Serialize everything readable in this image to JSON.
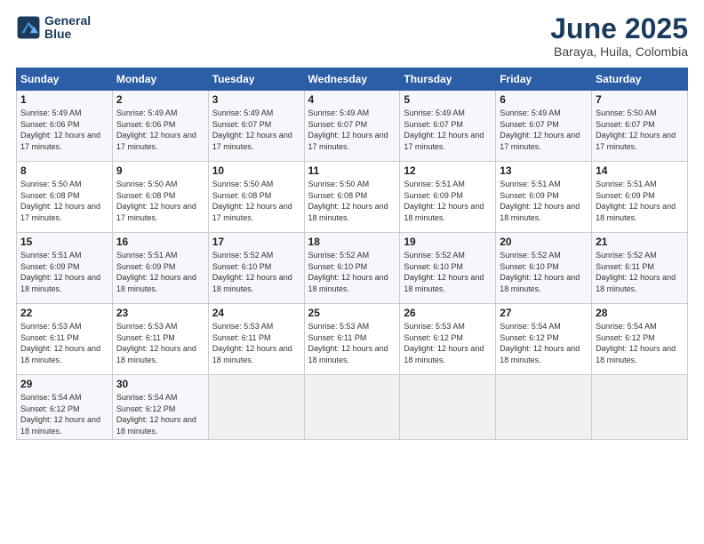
{
  "logo": {
    "line1": "General",
    "line2": "Blue"
  },
  "title": "June 2025",
  "subtitle": "Baraya, Huila, Colombia",
  "days_header": [
    "Sunday",
    "Monday",
    "Tuesday",
    "Wednesday",
    "Thursday",
    "Friday",
    "Saturday"
  ],
  "weeks": [
    [
      {
        "day": "1",
        "sunrise": "5:49 AM",
        "sunset": "6:06 PM",
        "daylight": "12 hours and 17 minutes."
      },
      {
        "day": "2",
        "sunrise": "5:49 AM",
        "sunset": "6:06 PM",
        "daylight": "12 hours and 17 minutes."
      },
      {
        "day": "3",
        "sunrise": "5:49 AM",
        "sunset": "6:07 PM",
        "daylight": "12 hours and 17 minutes."
      },
      {
        "day": "4",
        "sunrise": "5:49 AM",
        "sunset": "6:07 PM",
        "daylight": "12 hours and 17 minutes."
      },
      {
        "day": "5",
        "sunrise": "5:49 AM",
        "sunset": "6:07 PM",
        "daylight": "12 hours and 17 minutes."
      },
      {
        "day": "6",
        "sunrise": "5:49 AM",
        "sunset": "6:07 PM",
        "daylight": "12 hours and 17 minutes."
      },
      {
        "day": "7",
        "sunrise": "5:50 AM",
        "sunset": "6:07 PM",
        "daylight": "12 hours and 17 minutes."
      }
    ],
    [
      {
        "day": "8",
        "sunrise": "5:50 AM",
        "sunset": "6:08 PM",
        "daylight": "12 hours and 17 minutes."
      },
      {
        "day": "9",
        "sunrise": "5:50 AM",
        "sunset": "6:08 PM",
        "daylight": "12 hours and 17 minutes."
      },
      {
        "day": "10",
        "sunrise": "5:50 AM",
        "sunset": "6:08 PM",
        "daylight": "12 hours and 17 minutes."
      },
      {
        "day": "11",
        "sunrise": "5:50 AM",
        "sunset": "6:08 PM",
        "daylight": "12 hours and 18 minutes."
      },
      {
        "day": "12",
        "sunrise": "5:51 AM",
        "sunset": "6:09 PM",
        "daylight": "12 hours and 18 minutes."
      },
      {
        "day": "13",
        "sunrise": "5:51 AM",
        "sunset": "6:09 PM",
        "daylight": "12 hours and 18 minutes."
      },
      {
        "day": "14",
        "sunrise": "5:51 AM",
        "sunset": "6:09 PM",
        "daylight": "12 hours and 18 minutes."
      }
    ],
    [
      {
        "day": "15",
        "sunrise": "5:51 AM",
        "sunset": "6:09 PM",
        "daylight": "12 hours and 18 minutes."
      },
      {
        "day": "16",
        "sunrise": "5:51 AM",
        "sunset": "6:09 PM",
        "daylight": "12 hours and 18 minutes."
      },
      {
        "day": "17",
        "sunrise": "5:52 AM",
        "sunset": "6:10 PM",
        "daylight": "12 hours and 18 minutes."
      },
      {
        "day": "18",
        "sunrise": "5:52 AM",
        "sunset": "6:10 PM",
        "daylight": "12 hours and 18 minutes."
      },
      {
        "day": "19",
        "sunrise": "5:52 AM",
        "sunset": "6:10 PM",
        "daylight": "12 hours and 18 minutes."
      },
      {
        "day": "20",
        "sunrise": "5:52 AM",
        "sunset": "6:10 PM",
        "daylight": "12 hours and 18 minutes."
      },
      {
        "day": "21",
        "sunrise": "5:52 AM",
        "sunset": "6:11 PM",
        "daylight": "12 hours and 18 minutes."
      }
    ],
    [
      {
        "day": "22",
        "sunrise": "5:53 AM",
        "sunset": "6:11 PM",
        "daylight": "12 hours and 18 minutes."
      },
      {
        "day": "23",
        "sunrise": "5:53 AM",
        "sunset": "6:11 PM",
        "daylight": "12 hours and 18 minutes."
      },
      {
        "day": "24",
        "sunrise": "5:53 AM",
        "sunset": "6:11 PM",
        "daylight": "12 hours and 18 minutes."
      },
      {
        "day": "25",
        "sunrise": "5:53 AM",
        "sunset": "6:11 PM",
        "daylight": "12 hours and 18 minutes."
      },
      {
        "day": "26",
        "sunrise": "5:53 AM",
        "sunset": "6:12 PM",
        "daylight": "12 hours and 18 minutes."
      },
      {
        "day": "27",
        "sunrise": "5:54 AM",
        "sunset": "6:12 PM",
        "daylight": "12 hours and 18 minutes."
      },
      {
        "day": "28",
        "sunrise": "5:54 AM",
        "sunset": "6:12 PM",
        "daylight": "12 hours and 18 minutes."
      }
    ],
    [
      {
        "day": "29",
        "sunrise": "5:54 AM",
        "sunset": "6:12 PM",
        "daylight": "12 hours and 18 minutes."
      },
      {
        "day": "30",
        "sunrise": "5:54 AM",
        "sunset": "6:12 PM",
        "daylight": "12 hours and 18 minutes."
      },
      null,
      null,
      null,
      null,
      null
    ]
  ]
}
